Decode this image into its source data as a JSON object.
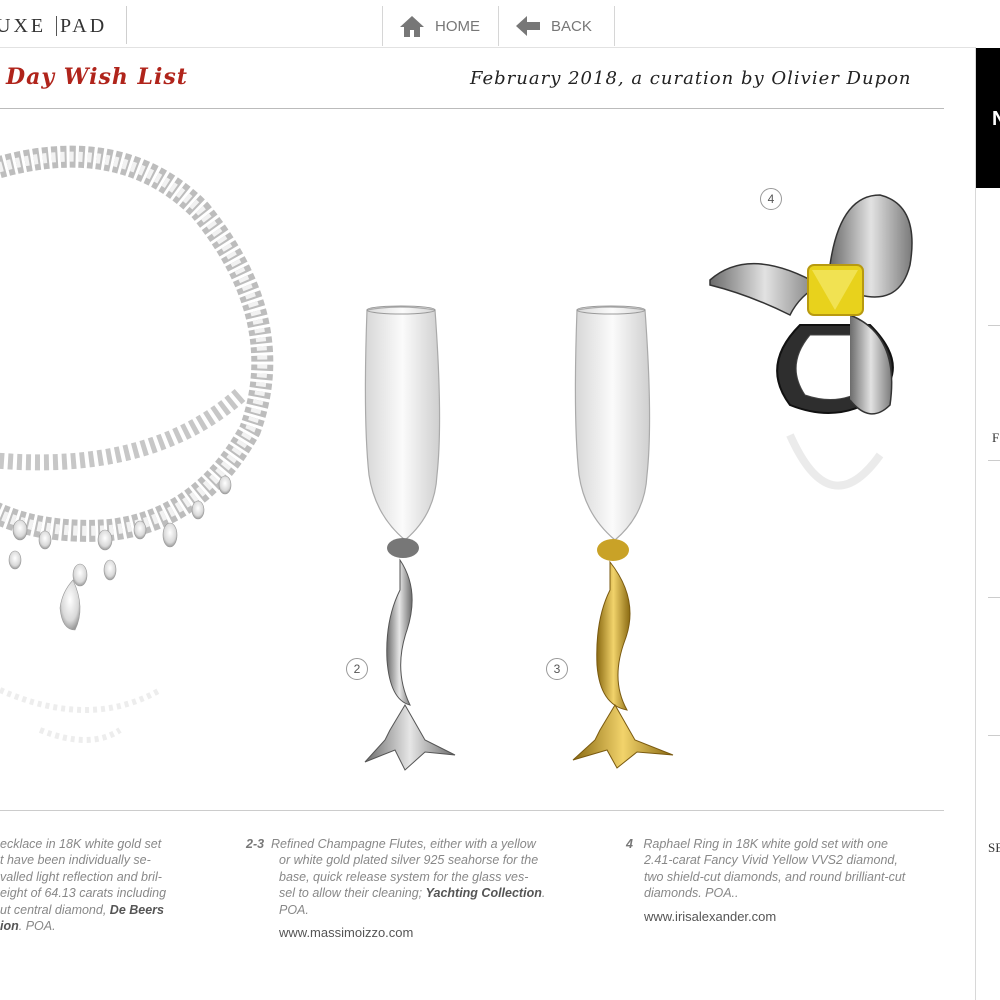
{
  "topbar": {
    "logo": {
      "left": "UXE",
      "right": "PAD"
    },
    "home_label": "HOME",
    "back_label": "BACK"
  },
  "header": {
    "title": "Day Wish List",
    "subtitle": "February 2018, a curation by Olivier Dupon"
  },
  "right_panel": {
    "black_box_letter": "N",
    "items": [
      "F",
      "SE"
    ]
  },
  "badges": [
    "2",
    "3",
    "4"
  ],
  "captions": {
    "col1": {
      "lines": [
        "ecklace in 18K white gold set",
        "t have been individually se-",
        "valled light reflection and bril-",
        "eight of 64.13 carats including",
        "ut central diamond,"
      ],
      "brand_a": "De Beers",
      "brand_b": "ion",
      "tail": ". POA."
    },
    "col2": {
      "number": "2-3",
      "lines": [
        "Refined Champagne Flutes, either with a yellow",
        "or white gold plated silver 925 seahorse for the",
        "base, quick release system for the glass ves-",
        "sel to allow their cleaning;"
      ],
      "brand": "Yachting Collection",
      "tail": ". POA.",
      "website": "www.massimoizzo.com"
    },
    "col3": {
      "number": "4",
      "lines": [
        "Raphael Ring in 18K white gold set with one",
        "2.41-carat Fancy Vivid Yellow VVS2 diamond,",
        "two shield-cut diamonds, and round brilliant-cut",
        "diamonds. POA.."
      ],
      "website": "www.irisalexander.com"
    }
  },
  "colors": {
    "title_red": "#b0241b",
    "gold": "#c9a227",
    "yellow_stone": "#e8d21c"
  }
}
